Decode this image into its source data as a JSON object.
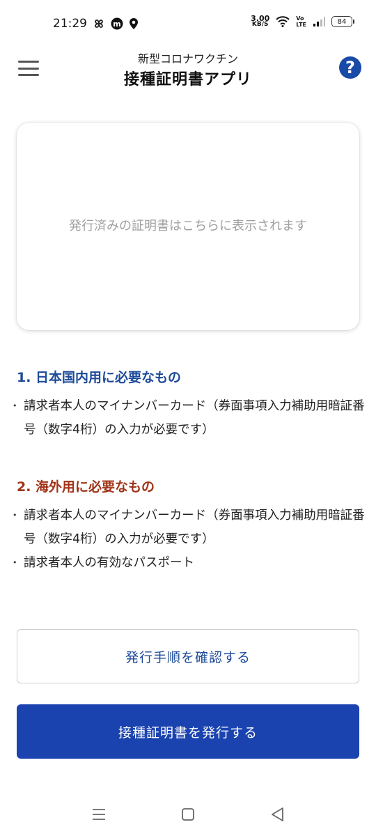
{
  "status_bar": {
    "time": "21:29",
    "net_speed_value": "3.00",
    "net_speed_unit": "KB/S",
    "volte_top": "Vo",
    "volte_bottom": "LTE",
    "battery": "84"
  },
  "header": {
    "subtitle": "新型コロナワクチン",
    "title": "接種証明書アプリ",
    "help_label": "?"
  },
  "certificate_area": {
    "placeholder": "発行済みの証明書はこちらに表示されます"
  },
  "sections": [
    {
      "title": "1. 日本国内用に必要なもの",
      "color": "#1d4a99",
      "items": [
        "請求者本人のマイナンバーカード（券面事項入力補助用暗証番号（数字4桁）の入力が必要です）"
      ]
    },
    {
      "title": "2. 海外用に必要なもの",
      "color": "#a03318",
      "items": [
        "請求者本人のマイナンバーカード（券面事項入力補助用暗証番号（数字4桁）の入力が必要です）",
        "請求者本人の有効なパスポート"
      ]
    }
  ],
  "buttons": {
    "check_procedure": "発行手順を確認する",
    "issue_certificate": "接種証明書を発行する"
  },
  "colors": {
    "primary": "#1a43b0",
    "help": "#1a4aa8"
  }
}
